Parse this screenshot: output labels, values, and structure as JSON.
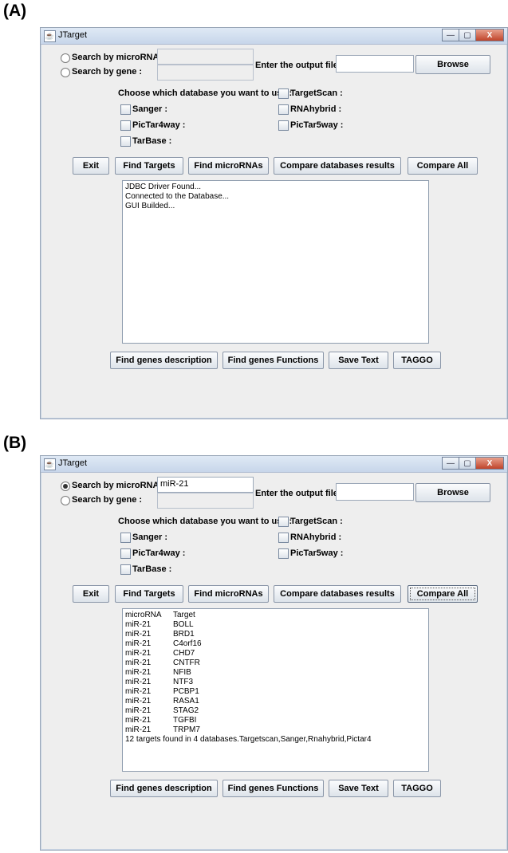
{
  "panel_a": {
    "label": "(A)",
    "window_title": "JTarget",
    "window_buttons": {
      "minimize": "—",
      "maximize": "▢",
      "close": "X"
    },
    "search_microrna_label": "Search by microRNA:",
    "search_gene_label": "Search by gene :",
    "search_microrna_value": "",
    "search_gene_value": "",
    "search_microrna_selected": false,
    "output_file_label": "Enter the output file :",
    "output_file_value": "",
    "browse_label": "Browse",
    "database_prompt": "Choose which database you want to use :",
    "databases": {
      "targetscan": "TargetScan :",
      "sanger": "Sanger :",
      "rnahybrid": "RNAhybrid :",
      "pictar4way": "PicTar4way :",
      "pictar5way": "PicTar5way :",
      "tarbase": "TarBase :"
    },
    "buttons": {
      "exit": "Exit",
      "find_targets": "Find Targets",
      "find_micrornas": "Find microRNAs",
      "compare_db": "Compare databases results",
      "compare_all": "Compare All"
    },
    "log_lines": [
      "JDBC Driver Found...",
      "Connected to the Database...",
      "GUI Builded..."
    ],
    "bottom_buttons": {
      "genes_description": "Find genes description",
      "genes_functions": "Find genes Functions",
      "save_text": "Save Text",
      "taggo": "TAGGO"
    }
  },
  "panel_b": {
    "label": "(B)",
    "window_title": "JTarget",
    "window_buttons": {
      "minimize": "—",
      "maximize": "▢",
      "close": "X"
    },
    "search_microrna_label": "Search by microRNA:",
    "search_gene_label": "Search by gene :",
    "search_microrna_value": "miR-21",
    "search_gene_value": "",
    "search_microrna_selected": true,
    "output_file_label": "Enter the output file :",
    "output_file_value": "",
    "browse_label": "Browse",
    "database_prompt": "Choose which database you want to use :",
    "databases": {
      "targetscan": "TargetScan :",
      "sanger": "Sanger :",
      "rnahybrid": "RNAhybrid :",
      "pictar4way": "PicTar4way :",
      "pictar5way": "PicTar5way :",
      "tarbase": "TarBase :"
    },
    "buttons": {
      "exit": "Exit",
      "find_targets": "Find Targets",
      "find_micrornas": "Find microRNAs",
      "compare_db": "Compare databases results",
      "compare_all": "Compare All"
    },
    "results_header": {
      "col1": "microRNA",
      "col2": "Target"
    },
    "results": [
      {
        "mirna": "miR-21",
        "target": "BOLL"
      },
      {
        "mirna": "miR-21",
        "target": "BRD1"
      },
      {
        "mirna": "miR-21",
        "target": "C4orf16"
      },
      {
        "mirna": "miR-21",
        "target": "CHD7"
      },
      {
        "mirna": "miR-21",
        "target": "CNTFR"
      },
      {
        "mirna": "miR-21",
        "target": "NFIB"
      },
      {
        "mirna": "miR-21",
        "target": "NTF3"
      },
      {
        "mirna": "miR-21",
        "target": "PCBP1"
      },
      {
        "mirna": "miR-21",
        "target": "RASA1"
      },
      {
        "mirna": "miR-21",
        "target": "STAG2"
      },
      {
        "mirna": "miR-21",
        "target": "TGFBI"
      },
      {
        "mirna": "miR-21",
        "target": "TRPM7"
      }
    ],
    "results_summary": "12 targets found in 4 databases.Targetscan,Sanger,Rnahybrid,Pictar4",
    "bottom_buttons": {
      "genes_description": "Find genes description",
      "genes_functions": "Find genes Functions",
      "save_text": "Save Text",
      "taggo": "TAGGO"
    }
  }
}
